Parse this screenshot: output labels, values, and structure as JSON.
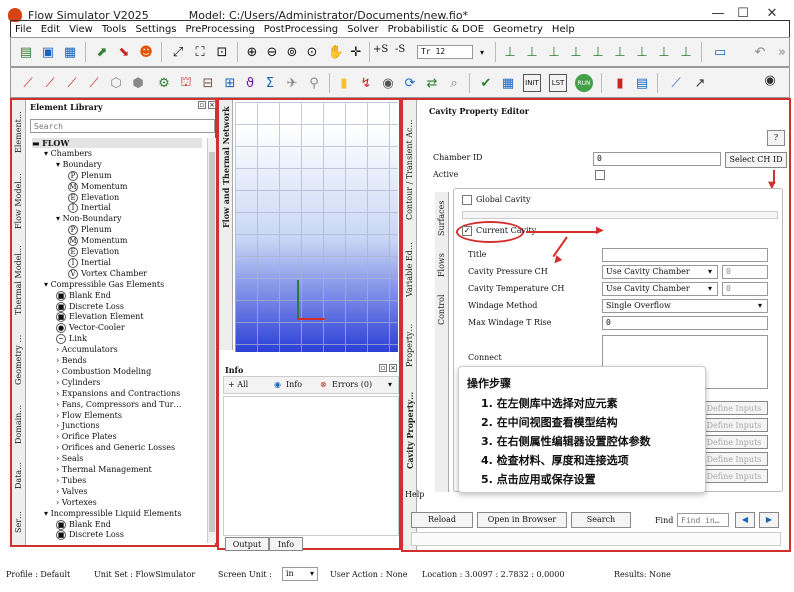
{
  "window": {
    "title": "Flow Simulator V2025",
    "model": "Model: C:/Users/Administrator/Documents/new.fio*",
    "min": "—",
    "max": "☐",
    "close": "✕"
  },
  "menu": [
    "File",
    "Edit",
    "View",
    "Tools",
    "Settings",
    "PreProcessing",
    "PostProcessing",
    "Solver",
    "Probabilistic & DOE",
    "Geometry",
    "Help"
  ],
  "toolbar1": {
    "font_value": "Tr 12",
    "s_plus": "+S",
    "s_minus": "-S"
  },
  "toolbar2": {
    "help_label": "Help"
  },
  "left_tabs": [
    "Element…",
    "Flow Model…",
    "Thermal Model…",
    "Geometry …",
    "Domain…",
    "Data…",
    "Ser…"
  ],
  "element_library": {
    "title": "Element Library",
    "search_placeholder": "Search",
    "tree": [
      {
        "t": "FLOW",
        "d": 0,
        "e": "▬"
      },
      {
        "t": "Chambers",
        "d": 1,
        "e": "▾"
      },
      {
        "t": "Boundary",
        "d": 2,
        "e": "▾"
      },
      {
        "t": "Plenum",
        "d": 3,
        "i": "P"
      },
      {
        "t": "Momentum",
        "d": 3,
        "i": "M"
      },
      {
        "t": "Elevation",
        "d": 3,
        "i": "E"
      },
      {
        "t": "Inertial",
        "d": 3,
        "i": "I"
      },
      {
        "t": "Non-Boundary",
        "d": 2,
        "e": "▾"
      },
      {
        "t": "Plenum",
        "d": 3,
        "i": "P"
      },
      {
        "t": "Momentum",
        "d": 3,
        "i": "M"
      },
      {
        "t": "Elevation",
        "d": 3,
        "i": "E"
      },
      {
        "t": "Inertial",
        "d": 3,
        "i": "I"
      },
      {
        "t": "Vortex Chamber",
        "d": 3,
        "i": "V"
      },
      {
        "t": "Compressible Gas Elements",
        "d": 1,
        "e": "▾"
      },
      {
        "t": "Blank End",
        "d": 2,
        "i": "■"
      },
      {
        "t": "Discrete Loss",
        "d": 2,
        "i": "■"
      },
      {
        "t": "Elevation Element",
        "d": 2,
        "i": "■"
      },
      {
        "t": "Vector-Cooler",
        "d": 2,
        "i": "●"
      },
      {
        "t": "Link",
        "d": 2,
        "i": "~"
      },
      {
        "t": "Accumulators",
        "d": 2,
        "e": "›"
      },
      {
        "t": "Bends",
        "d": 2,
        "e": "›"
      },
      {
        "t": "Combustion Modeling",
        "d": 2,
        "e": "›"
      },
      {
        "t": "Cylinders",
        "d": 2,
        "e": "›"
      },
      {
        "t": "Expansions and Contractions",
        "d": 2,
        "e": "›"
      },
      {
        "t": "Fans, Compressors and Tur…",
        "d": 2,
        "e": "›"
      },
      {
        "t": "Flow Elements",
        "d": 2,
        "e": "›"
      },
      {
        "t": "Junctions",
        "d": 2,
        "e": "›"
      },
      {
        "t": "Orifice Plates",
        "d": 2,
        "e": "›"
      },
      {
        "t": "Orifices and Generic Losses",
        "d": 2,
        "e": "›"
      },
      {
        "t": "Seals",
        "d": 2,
        "e": "›"
      },
      {
        "t": "Thermal Management",
        "d": 2,
        "e": "›"
      },
      {
        "t": "Tubes",
        "d": 2,
        "e": "›"
      },
      {
        "t": "Valves",
        "d": 2,
        "e": "›"
      },
      {
        "t": "Vortexes",
        "d": 2,
        "e": "›"
      },
      {
        "t": "Incompressible Liquid Elements",
        "d": 1,
        "e": "▾"
      },
      {
        "t": "Blank End",
        "d": 2,
        "i": "■"
      },
      {
        "t": "Discrete Loss",
        "d": 2,
        "i": "■"
      }
    ]
  },
  "mid": {
    "vtab": "Flow and Thermal Network",
    "info_title": "Info",
    "all": "+ All",
    "info": "Info",
    "errors": "Errors (0)",
    "tab_output": "Output",
    "tab_info": "Info"
  },
  "cavity": {
    "title": "Cavity Property Editor",
    "help_btn": "?",
    "chamber_id_label": "Chamber ID",
    "chamber_id_value": "0",
    "select_btn": "Select CH ID",
    "active_label": "Active",
    "side_tabs": [
      "Contour / Transient Ac…",
      "Variable Ed…",
      "Property…",
      "Cavity Property…"
    ],
    "inner_tabs": [
      "Surfaces",
      "Flows",
      "Control"
    ],
    "global_cavity": "Global Cavity",
    "current_cavity": "Current Cavity",
    "title_label": "Title",
    "pressure_label": "Cavity Pressure CH",
    "pressure_sel": "Use Cavity Chamber",
    "pressure_val": "0",
    "temp_label": "Cavity Temperature CH",
    "temp_sel": "Use Cavity Chamber",
    "temp_val": "0",
    "windage_label": "Windage Method",
    "windage_sel": "Single Overflow",
    "maxwind_label": "Max Windage T Rise",
    "maxwind_val": "0",
    "connect_label": "Connect",
    "define_inputs": [
      "Define Inputs",
      "Define Inputs",
      "Define Inputs",
      "Define Inputs",
      "Define Inputs"
    ],
    "help_label": "Help",
    "reload": "Reload",
    "open_browser": "Open in Browser",
    "search": "Search",
    "find_label": "Find",
    "find_placeholder": "Find in…"
  },
  "overlay": {
    "heading": "操作步骤",
    "steps": [
      "1. 在左侧库中选择对应元素",
      "2. 在中间视图查看模型结构",
      "3. 在右侧属性编辑器设置腔体参数",
      "4. 检查材料、厚度和连接选项",
      "5. 点击应用或保存设置"
    ]
  },
  "status": {
    "profile": "Profile : Default",
    "unit_set": "Unit Set :  FlowSimulator",
    "screen_unit": "Screen Unit :",
    "screen_unit_val": "in",
    "user_action": "User Action : None",
    "location": "Location :  3.0097   :  2.7832   :  0.0000",
    "results": "Results: None"
  }
}
